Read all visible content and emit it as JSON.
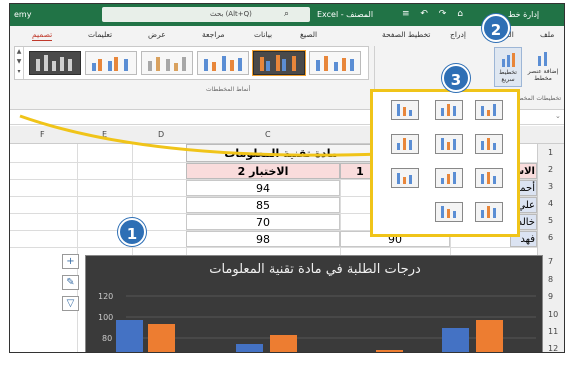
{
  "titlebar": {
    "left_text": "emy",
    "search_text": "بحث (Alt+Q)",
    "app_text": "Excel - المصنف",
    "icons_text": "≡ ↶ ↷ ⌂",
    "right_text": "إدارة خط"
  },
  "tabs": [
    {
      "label": "ملف"
    },
    {
      "label": "الرئيسي"
    },
    {
      "label": "إدراج"
    },
    {
      "label": "تخطيط الصفحة"
    },
    {
      "label": "الصيغ"
    },
    {
      "label": "بيانات"
    },
    {
      "label": "مراجعة"
    },
    {
      "label": "عرض"
    },
    {
      "label": "تعليمات"
    },
    {
      "label": "تصميم"
    }
  ],
  "ribbon": {
    "styles_label": "أنماط المخططات",
    "switch_label": "تخطيط سريع",
    "addel_label": "إضافة عنصر مخطط",
    "layouts_label": "تخطيطات المخطط"
  },
  "columns": [
    "F",
    "E",
    "D",
    "C"
  ],
  "rows": [
    "1",
    "2",
    "3",
    "4",
    "5",
    "6",
    "7",
    "8",
    "9",
    "10",
    "11",
    "12"
  ],
  "table": {
    "title": "مادة تقنية المعلومات",
    "header_test2": "الاختبار 2",
    "header_test1": "1",
    "header_name": "الاس",
    "names": [
      "أحمد",
      "علي",
      "خالد",
      "فهد"
    ],
    "test2": [
      "94",
      "85",
      "70",
      "98"
    ],
    "test1_row6": "90"
  },
  "chart": {
    "title": "درجات الطلبة في مادة تقنية المعلومات",
    "yticks": [
      "120",
      "100",
      "80"
    ],
    "colors": {
      "series1": "#4472c4",
      "series2": "#ed7d31"
    }
  },
  "badges": {
    "b1": "1",
    "b2": "2",
    "b3": "3"
  },
  "side_buttons": {
    "plus": "+",
    "brush": "✎",
    "filter": "▽"
  },
  "accent_colors": {
    "excel_green": "#217346",
    "highlight_yellow": "#f0c419",
    "badge_blue": "#2e6fb5"
  }
}
